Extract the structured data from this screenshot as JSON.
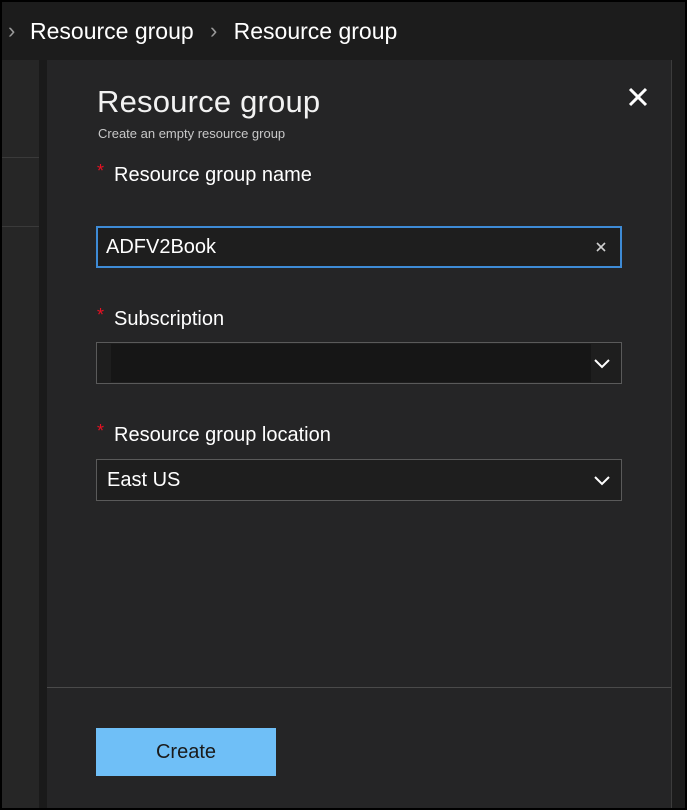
{
  "breadcrumb": {
    "items": [
      "Resource group",
      "Resource group"
    ]
  },
  "blade": {
    "title": "Resource group",
    "subtitle": "Create an empty resource group",
    "close_icon": "close-icon"
  },
  "form": {
    "required_marker": "*",
    "name": {
      "label": "Resource group name",
      "value": "ADFV2Book",
      "clear_icon": "clear-icon"
    },
    "subscription": {
      "label": "Subscription",
      "value": "",
      "redacted": true
    },
    "location": {
      "label": "Resource group location",
      "value": "East US"
    }
  },
  "actions": {
    "create_label": "Create"
  },
  "colors": {
    "accent": "#6fbff7",
    "focus_border": "#3e8bd6",
    "required": "#e81123",
    "panel": "#252526"
  }
}
